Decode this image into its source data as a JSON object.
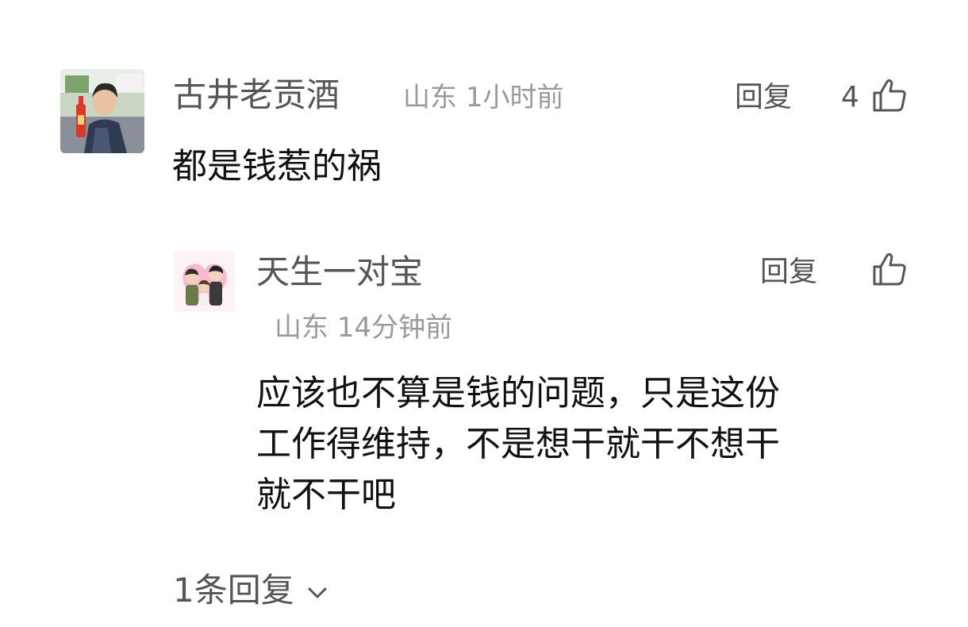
{
  "comment": {
    "username": "古井老贡酒",
    "location": "山东",
    "time": "1小时前",
    "reply_label": "回复",
    "like_count": "4",
    "content": "都是钱惹的祸",
    "avatar_icon": "user-avatar-photo",
    "like_icon": "thumbs-up-icon"
  },
  "reply": {
    "username": "天生一对宝",
    "location": "山东",
    "time": "14分钟前",
    "reply_label": "回复",
    "content_lines": [
      "应该也不算是钱的问题，只是这份",
      "工作得维持，不是想干就干不想干",
      "就不干吧"
    ],
    "avatar_icon": "family-cartoon-avatar",
    "like_icon": "thumbs-up-icon"
  },
  "replies_toggle": {
    "label": "1条回复",
    "icon": "chevron-down-icon"
  },
  "colors": {
    "primary_text": "#111111",
    "secondary_text": "#555555",
    "meta_text": "#9a9a9a",
    "background": "#ffffff"
  }
}
